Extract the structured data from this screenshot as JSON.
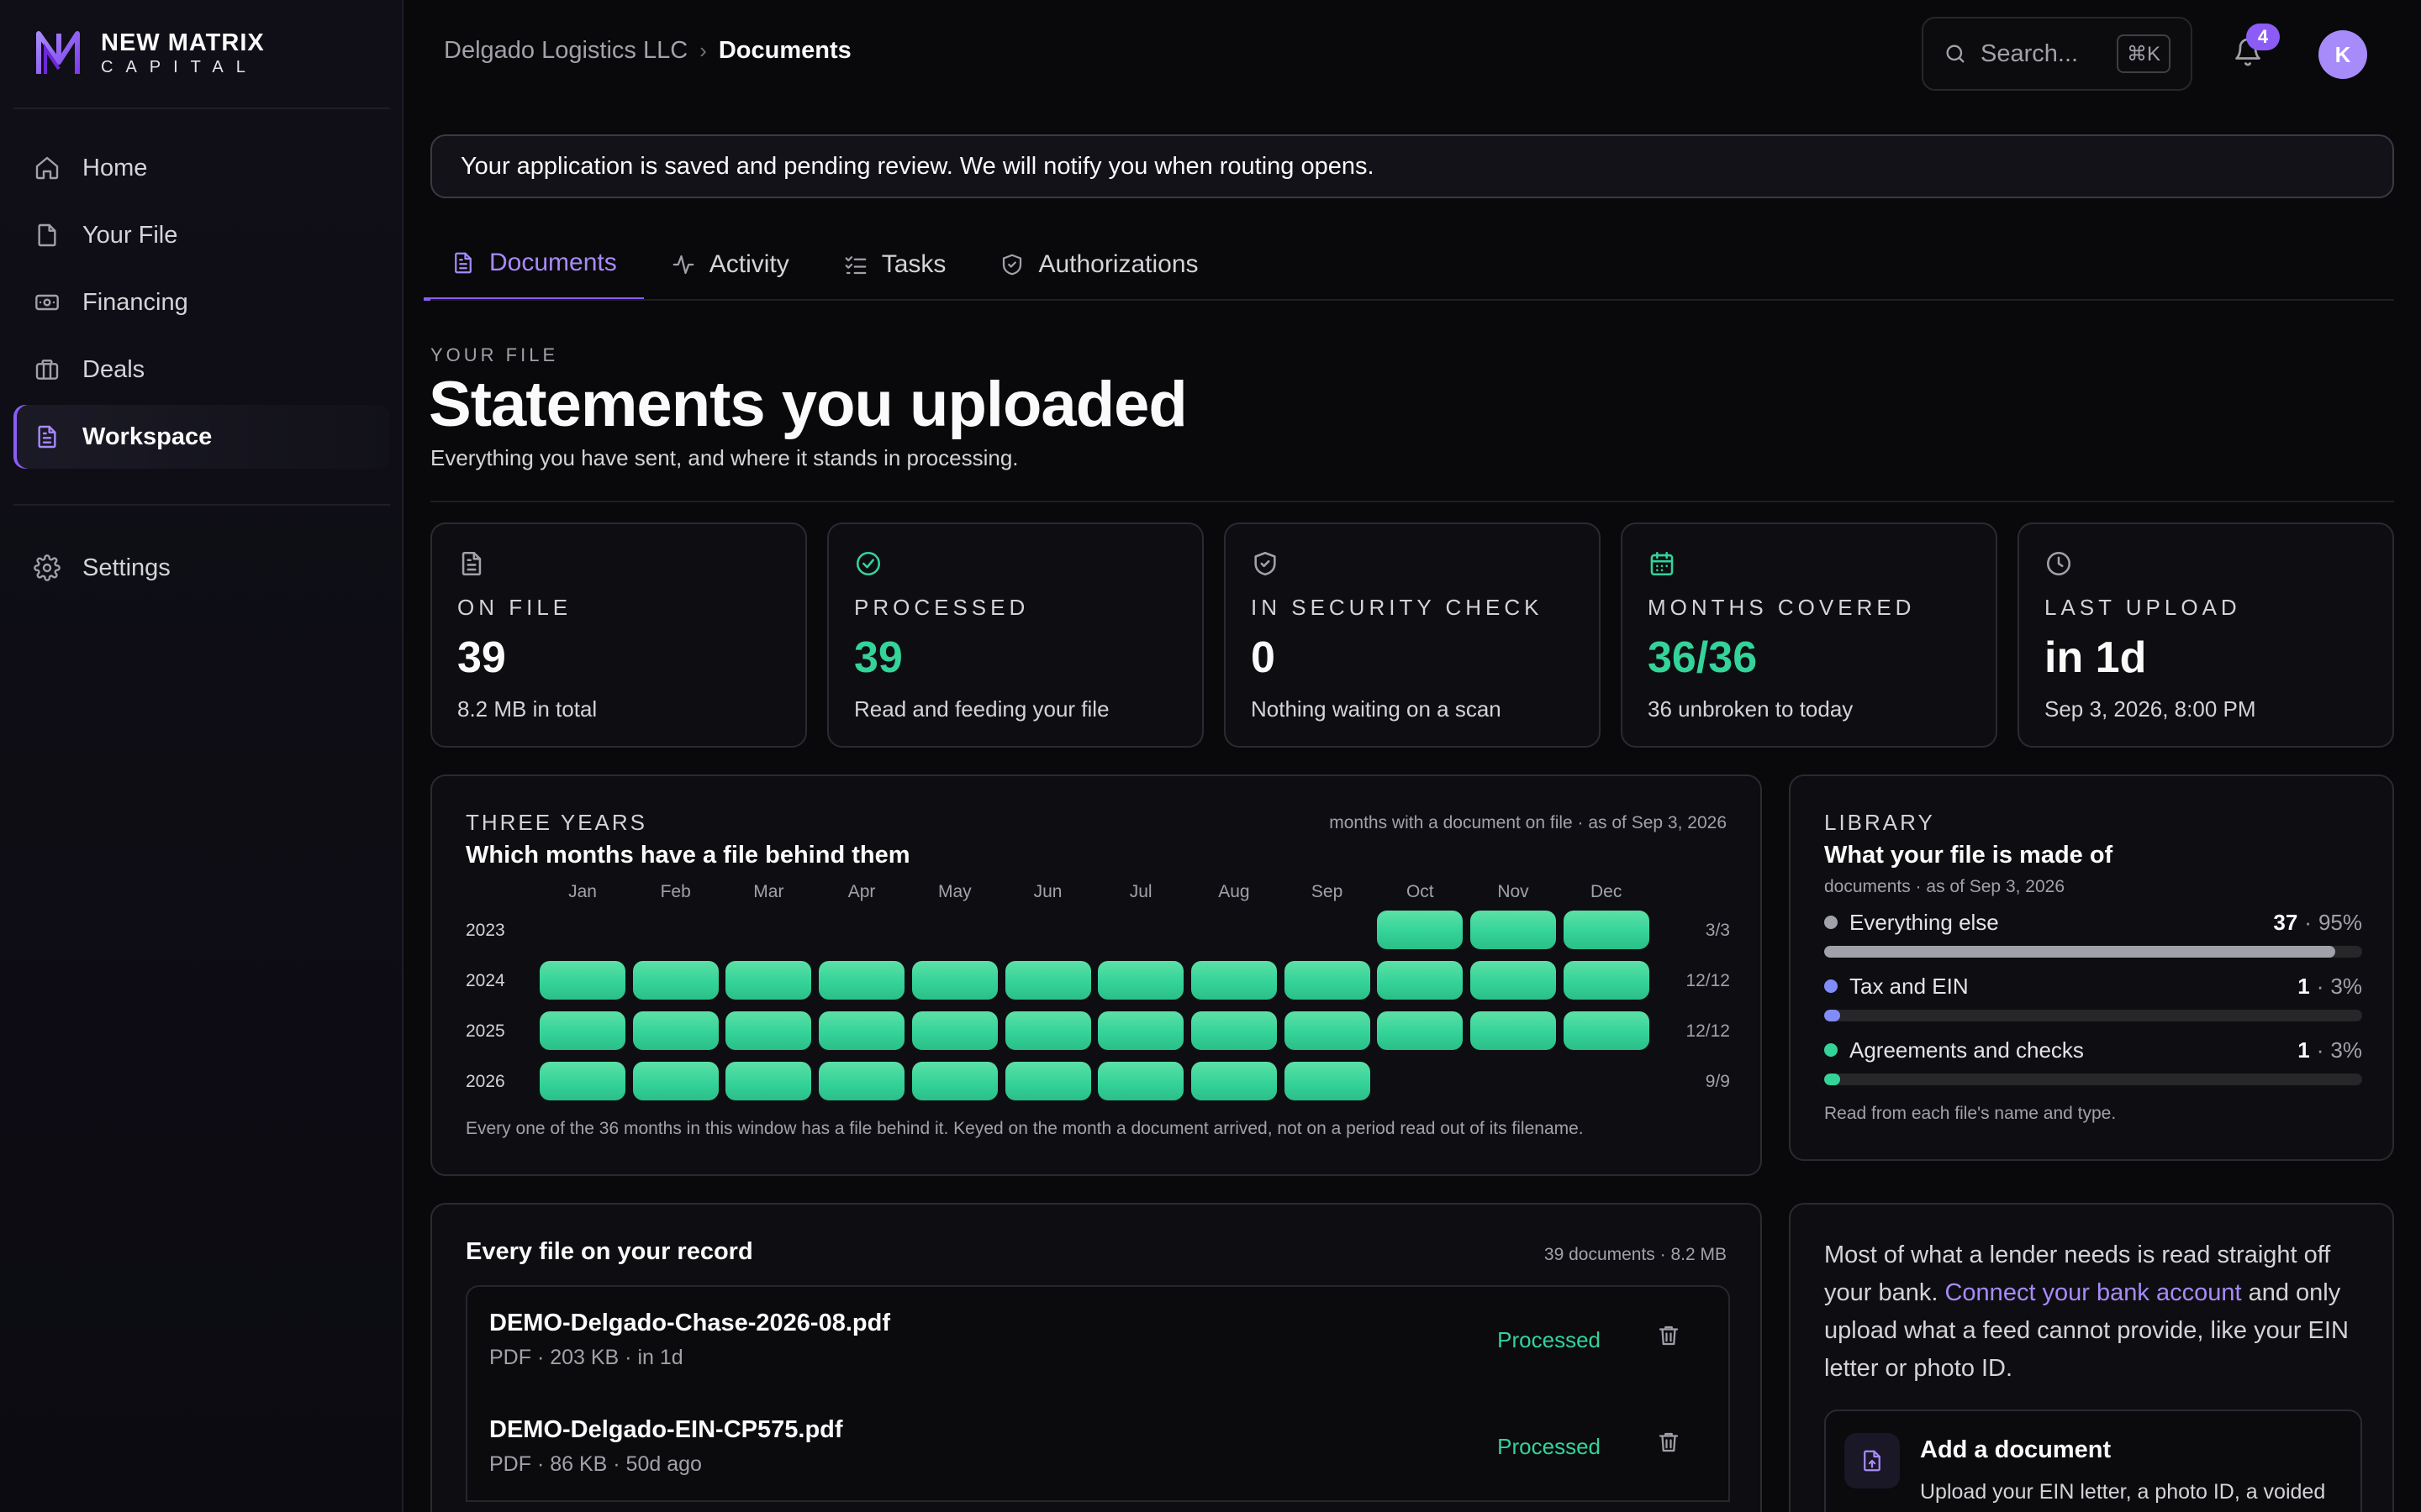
{
  "brand": {
    "name": "NEW MATRIX",
    "sub": "CAPITAL",
    "accent": "#8b5cf6"
  },
  "sidebar": {
    "items": [
      {
        "label": "Home",
        "icon": "home-icon"
      },
      {
        "label": "Your File",
        "icon": "file-icon"
      },
      {
        "label": "Financing",
        "icon": "banknote-icon"
      },
      {
        "label": "Deals",
        "icon": "briefcase-icon"
      },
      {
        "label": "Workspace",
        "icon": "document-icon",
        "active": true
      }
    ],
    "settings": {
      "label": "Settings",
      "icon": "gear-icon"
    }
  },
  "header": {
    "breadcrumb": {
      "parent": "Delgado Logistics LLC",
      "current": "Documents"
    },
    "search": {
      "placeholder": "Search...",
      "shortcut": "⌘K"
    },
    "notifications": {
      "count": "4"
    },
    "avatar": {
      "initial": "K"
    }
  },
  "banner": {
    "text": "Your application is saved and pending review. We will notify you when routing opens."
  },
  "tabs": [
    {
      "label": "Documents",
      "icon": "document-icon",
      "active": true
    },
    {
      "label": "Activity",
      "icon": "activity-icon"
    },
    {
      "label": "Tasks",
      "icon": "checklist-icon"
    },
    {
      "label": "Authorizations",
      "icon": "shield-icon"
    }
  ],
  "page": {
    "eyebrow": "YOUR FILE",
    "title": "Statements you uploaded",
    "subtitle": "Everything you have sent, and where it stands in processing."
  },
  "stats": [
    {
      "label": "ON FILE",
      "value": "39",
      "note": "8.2 MB in total",
      "icon": "file-icon",
      "value_color": "#fafafa"
    },
    {
      "label": "PROCESSED",
      "value": "39",
      "note": "Read and feeding your file",
      "icon": "check-circle-icon",
      "value_color": "#34d399"
    },
    {
      "label": "IN SECURITY CHECK",
      "value": "0",
      "note": "Nothing waiting on a scan",
      "icon": "shield-check-icon",
      "value_color": "#fafafa"
    },
    {
      "label": "MONTHS COVERED",
      "value": "36/36",
      "note": "36 unbroken to today",
      "icon": "calendar-icon",
      "value_color": "#34d399"
    },
    {
      "label": "LAST UPLOAD",
      "value": "in 1d",
      "note": "Sep 3, 2026, 8:00 PM",
      "icon": "clock-icon",
      "value_color": "#fafafa"
    }
  ],
  "calendar": {
    "eyebrow": "THREE YEARS",
    "title": "Which months have a file behind them",
    "meta": "months with a document on file · as of Sep 3, 2026",
    "months": [
      "Jan",
      "Feb",
      "Mar",
      "Apr",
      "May",
      "Jun",
      "Jul",
      "Aug",
      "Sep",
      "Oct",
      "Nov",
      "Dec"
    ],
    "rows": [
      {
        "year": "2023",
        "count": "3/3",
        "covered": [
          0,
          0,
          0,
          0,
          0,
          0,
          0,
          0,
          0,
          1,
          1,
          1
        ]
      },
      {
        "year": "2024",
        "count": "12/12",
        "covered": [
          1,
          1,
          1,
          1,
          1,
          1,
          1,
          1,
          1,
          1,
          1,
          1
        ]
      },
      {
        "year": "2025",
        "count": "12/12",
        "covered": [
          1,
          1,
          1,
          1,
          1,
          1,
          1,
          1,
          1,
          1,
          1,
          1
        ]
      },
      {
        "year": "2026",
        "count": "9/9",
        "covered": [
          1,
          1,
          1,
          1,
          1,
          1,
          1,
          1,
          1,
          0,
          0,
          0
        ]
      }
    ],
    "footnote": "Every one of the 36 months in this window has a file behind it. Keyed on the month a document arrived, not on a period read out of its filename."
  },
  "library": {
    "eyebrow": "LIBRARY",
    "title": "What your file is made of",
    "meta": "documents · as of Sep 3, 2026",
    "items": [
      {
        "name": "Everything else",
        "count": "37",
        "pct": "95%",
        "fraction": 0.95,
        "color": "#a1a1aa"
      },
      {
        "name": "Tax and EIN",
        "count": "1",
        "pct": "3%",
        "fraction": 0.03,
        "color": "#818cf8"
      },
      {
        "name": "Agreements and checks",
        "count": "1",
        "pct": "3%",
        "fraction": 0.03,
        "color": "#34d399"
      }
    ],
    "footnote": "Read from each file's name and type."
  },
  "files": {
    "title": "Every file on your record",
    "meta": "39 documents · 8.2 MB",
    "rows": [
      {
        "name": "DEMO-Delgado-Chase-2026-08.pdf",
        "meta": "PDF · 203 KB · in 1d",
        "status": "Processed"
      },
      {
        "name": "DEMO-Delgado-EIN-CP575.pdf",
        "meta": "PDF · 86 KB · 50d ago",
        "status": "Processed"
      }
    ]
  },
  "bank": {
    "text_before": "Most of what a lender needs is read straight off your bank. ",
    "link": "Connect your bank account",
    "text_after": " and only upload what a feed cannot provide, like your EIN letter or photo ID.",
    "add": {
      "title": "Add a document",
      "desc": "Upload your EIN letter, a photo ID, a voided"
    }
  }
}
